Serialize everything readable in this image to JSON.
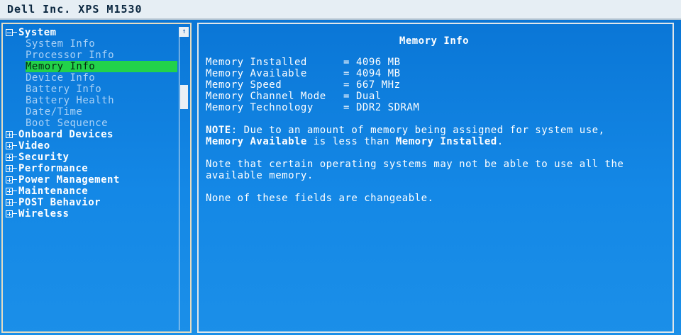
{
  "window": {
    "title": "Dell Inc. XPS M1530"
  },
  "tree": {
    "groups": [
      {
        "label": "System",
        "expanded": true,
        "children": [
          "System Info",
          "Processor Info",
          "Memory Info",
          "Device Info",
          "Battery Info",
          "Battery Health",
          "Date/Time",
          "Boot Sequence"
        ],
        "selected": "Memory Info"
      },
      {
        "label": "Onboard Devices",
        "expanded": false
      },
      {
        "label": "Video",
        "expanded": false
      },
      {
        "label": "Security",
        "expanded": false
      },
      {
        "label": "Performance",
        "expanded": false
      },
      {
        "label": "Power Management",
        "expanded": false
      },
      {
        "label": "Maintenance",
        "expanded": false
      },
      {
        "label": "POST Behavior",
        "expanded": false
      },
      {
        "label": "Wireless",
        "expanded": false
      }
    ]
  },
  "scrollbar": {
    "up_arrow": "↑"
  },
  "panel": {
    "heading": "Memory Info",
    "rows": [
      {
        "key": "Memory Installed",
        "value": "4096 MB"
      },
      {
        "key": "Memory Available",
        "value": "4094 MB"
      },
      {
        "key": "Memory Speed",
        "value": "667 MHz"
      },
      {
        "key": "Memory Channel Mode",
        "value": "Dual"
      },
      {
        "key": "Memory Technology",
        "value": "DDR2 SDRAM"
      }
    ],
    "equals": "=",
    "note": {
      "prefix": "NOTE",
      "part1": ": Due to an amount of memory being assigned for system use,",
      "bold1": "Memory Available",
      "part2": " is less than ",
      "bold2": "Memory Installed",
      "part3": "."
    },
    "para2": "Note that certain operating systems may not be able to use all the available memory.",
    "para3": "None of these fields are changeable."
  },
  "colors": {
    "background": "#0f7ad8",
    "selection": "#22d24a",
    "titlebar": "#e6eef4"
  }
}
